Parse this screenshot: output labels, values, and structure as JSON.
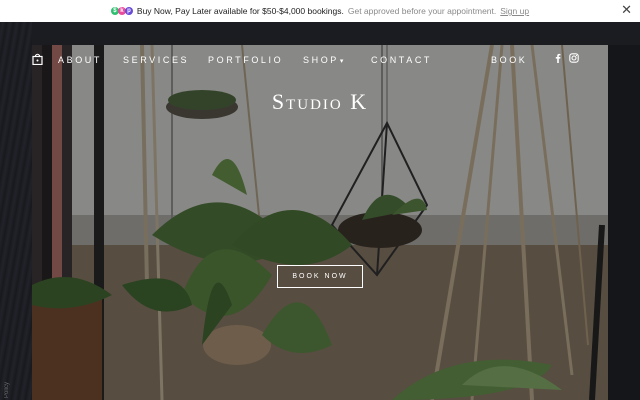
{
  "promo": {
    "logo_letters": [
      "$",
      "k",
      "p"
    ],
    "main_text": "Buy Now, Pay Later available for $50-$4,000 bookings.",
    "sub_text": "Get approved before your appointment.",
    "link_text": "Sign up",
    "close_icon": "close-icon"
  },
  "nav": {
    "items": [
      "ABOUT",
      "SERVICES",
      "PORTFOLIO",
      "SHOP",
      "CONTACT",
      "BOOK"
    ],
    "shop_caret": "ˇ",
    "cart_icon": "shopping-bag-icon",
    "social": [
      "facebook-icon",
      "instagram-icon"
    ]
  },
  "hero": {
    "title": "Studio K",
    "cta_label": "BOOK NOW"
  },
  "side_text": "Policy",
  "colors": {
    "background": "#16171b",
    "promo_bg": "#ffffff",
    "nav_text": "#ffffff",
    "overlay": "rgba(20,20,22,0.45)"
  }
}
